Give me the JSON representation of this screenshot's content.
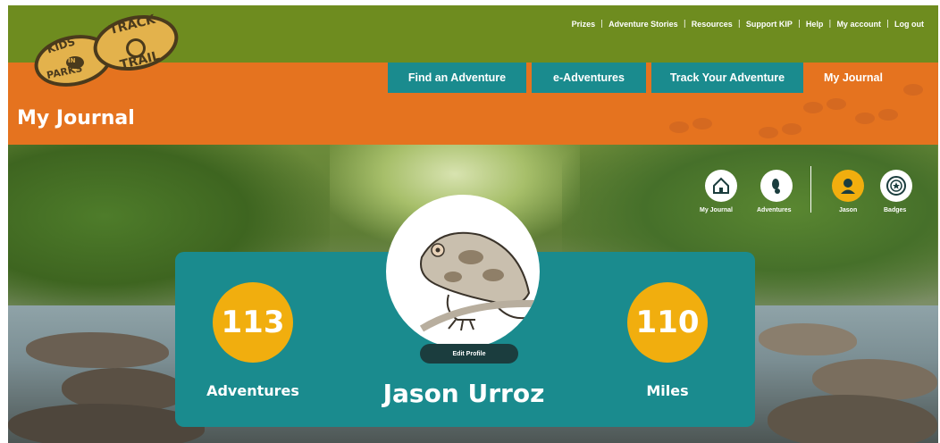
{
  "logo": {
    "text_top": "TRACK",
    "text_left": "KIDS",
    "text_middle": "IN",
    "text_bottom_left": "PARKS",
    "text_bottom_right": "TRAIL"
  },
  "utility_nav": {
    "items": [
      "Prizes",
      "Adventure Stories",
      "Resources",
      "Support KIP",
      "Help",
      "My account",
      "Log out"
    ],
    "separator": "|"
  },
  "tabs": [
    {
      "label": "Find an Adventure"
    },
    {
      "label": "e-Adventures"
    },
    {
      "label": "Track Your Adventure"
    },
    {
      "label": "My Journal"
    }
  ],
  "page_title": "My Journal",
  "journal_nav": [
    {
      "label": "My Journal",
      "icon": "home-icon"
    },
    {
      "label": "Adventures",
      "icon": "footprint-icon"
    },
    {
      "label": "Jason",
      "icon": "user-icon"
    },
    {
      "label": "Badges",
      "icon": "badge-icon"
    }
  ],
  "profile": {
    "name": "Jason Urroz",
    "edit_label": "Edit Profile",
    "avatar": "frog-avatar"
  },
  "stats": {
    "adventures_value": "113",
    "adventures_label": "Adventures",
    "miles_value": "110",
    "miles_label": "Miles"
  },
  "colors": {
    "green": "#6e8c1f",
    "orange": "#e5731f",
    "teal": "#1a8b8e",
    "gold": "#f1ae0e"
  }
}
